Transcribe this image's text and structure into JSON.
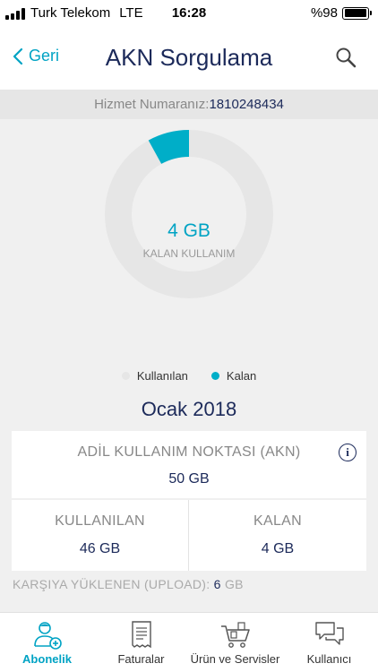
{
  "status_bar": {
    "carrier": "Turk Telekom",
    "network": "LTE",
    "time": "16:28",
    "battery": "%98",
    "battery_level": 0.98
  },
  "nav": {
    "back_label": "Geri",
    "title": "AKN Sorgulama",
    "icons": {
      "back": "chevron-left-icon",
      "search": "search-icon"
    }
  },
  "service": {
    "label": "Hizmet Numaranız:",
    "number": "1810248434"
  },
  "chart_data": {
    "type": "pie",
    "style": "donut",
    "categories": [
      "Kullanılan",
      "Kalan"
    ],
    "values": [
      46,
      4
    ],
    "unit": "GB",
    "colors": [
      "#e6e6e6",
      "#00aec8"
    ],
    "center_value": "4 GB",
    "center_label": "KALAN KULLANIM",
    "legend_position": "bottom"
  },
  "month": "Ocak 2018",
  "akn": {
    "label": "ADİL KULLANIM NOKTASI (AKN)",
    "value": "50 GB"
  },
  "used": {
    "label": "KULLANILAN",
    "value": "46 GB"
  },
  "remaining": {
    "label": "KALAN",
    "value": "4 GB"
  },
  "upload": {
    "label": "KARŞIYA YÜKLENEN (UPLOAD):",
    "value": "6",
    "unit": "GB"
  },
  "tabs": [
    {
      "label": "Abonelik",
      "icon": "user-add-icon",
      "active": true
    },
    {
      "label": "Faturalar",
      "icon": "receipt-icon",
      "active": false
    },
    {
      "label": "Ürün ve Servisler",
      "icon": "cart-icon",
      "active": false
    },
    {
      "label": "Kullanıcı",
      "icon": "chat-bubbles-icon",
      "active": false
    }
  ],
  "colors": {
    "accent": "#00a3c4",
    "navy": "#1c2a5a",
    "muted": "#888888",
    "track": "#e6e6e6"
  }
}
